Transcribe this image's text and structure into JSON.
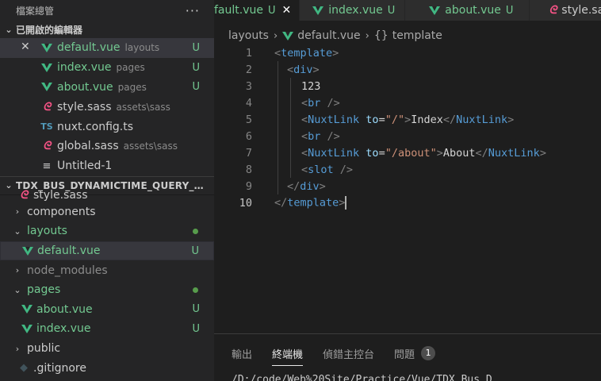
{
  "sidebar": {
    "title": "檔案總管",
    "more_label": "···",
    "open_editors_label": "已開啟的編輯器",
    "open_editors": [
      {
        "name": "default.vue",
        "desc": "layouts",
        "status": "U",
        "icon": "vue-icon"
      },
      {
        "name": "index.vue",
        "desc": "pages",
        "status": "U",
        "icon": "vue-icon"
      },
      {
        "name": "about.vue",
        "desc": "pages",
        "status": "U",
        "icon": "vue-icon"
      },
      {
        "name": "style.sass",
        "desc": "assets\\sass",
        "status": "",
        "icon": "sass-icon"
      },
      {
        "name": "nuxt.config.ts",
        "desc": "",
        "status": "",
        "icon": "ts-icon"
      },
      {
        "name": "global.sass",
        "desc": "assets\\sass",
        "status": "",
        "icon": "sass-icon"
      },
      {
        "name": "Untitled-1",
        "desc": "",
        "status": "",
        "icon": "text-file-icon"
      }
    ],
    "workspace_label": "TDX_BUS_DYNAMICTIME_QUERY_APPLI...",
    "tree": [
      {
        "name": "style.sass"
      },
      {
        "name": "components"
      },
      {
        "name": "layouts"
      },
      {
        "name": "default.vue",
        "status": "U"
      },
      {
        "name": "node_modules"
      },
      {
        "name": "pages"
      },
      {
        "name": "about.vue",
        "status": "U"
      },
      {
        "name": "index.vue",
        "status": "U"
      },
      {
        "name": "public"
      },
      {
        "name": ".gitignore"
      }
    ]
  },
  "tabs": [
    {
      "label": "fault.vue",
      "status": "U",
      "close": "✕"
    },
    {
      "label": "index.vue",
      "status": "U"
    },
    {
      "label": "about.vue",
      "status": "U"
    },
    {
      "label": "style.sass"
    }
  ],
  "breadcrumb": {
    "folder": "layouts",
    "file": "default.vue",
    "symbol_icon": "{}",
    "symbol": "template"
  },
  "editor": {
    "line_numbers": [
      "1",
      "2",
      "3",
      "4",
      "5",
      "6",
      "7",
      "8",
      "9",
      "10"
    ],
    "current_line": "10",
    "l1": {
      "open": "<",
      "tag": "template",
      "close": ">"
    },
    "l2": {
      "open": "<",
      "tag": "div",
      "close": ">"
    },
    "l3": {
      "text": "123"
    },
    "l4": {
      "open": "<",
      "tag": "br",
      "close": " />"
    },
    "l5": {
      "open": "<",
      "tag": "NuxtLink",
      "attr": " to",
      "eq": "=",
      "val": "\"/\"",
      "close": ">",
      "text": "Index",
      "open2": "</",
      "tag2": "NuxtLink",
      "close2": ">"
    },
    "l6": {
      "open": "<",
      "tag": "br",
      "close": " />"
    },
    "l7": {
      "open": "<",
      "tag": "NuxtLink",
      "attr": " to",
      "eq": "=",
      "val": "\"/about\"",
      "close": ">",
      "text": "About",
      "open2": "</",
      "tag2": "NuxtLink",
      "close2": ">"
    },
    "l8": {
      "open": "<",
      "tag": "slot",
      "close": " />"
    },
    "l9": {
      "open": "</",
      "tag": "div",
      "close": ">"
    },
    "l10": {
      "open": "</",
      "tag": "template",
      "close": ">"
    }
  },
  "panel": {
    "tabs": [
      "輸出",
      "終端機",
      "偵錯主控台",
      "問題"
    ],
    "active_tab": "終端機",
    "problems_count": "1",
    "terminal_line": "                    /D:/code/Web%20Site/Practice/Vue/TDX_Bus_D"
  },
  "colors": {
    "vue": "#41b883",
    "sass": "#f55385",
    "ts": "#519aba",
    "untracked": "#73c991",
    "folder_modified_dot": "#579c4c"
  }
}
